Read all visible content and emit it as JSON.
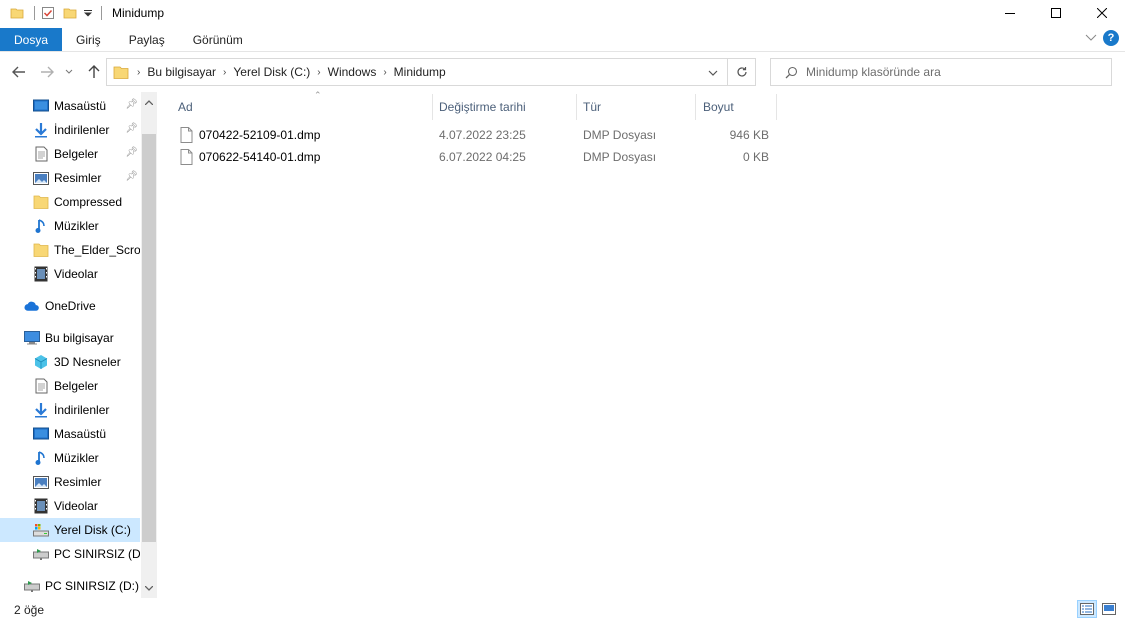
{
  "window": {
    "title": "Minidump",
    "controls": [
      "minimize",
      "maximize",
      "close"
    ]
  },
  "ribbon": {
    "tabs": [
      {
        "label": "Dosya",
        "active": true
      },
      {
        "label": "Giriş"
      },
      {
        "label": "Paylaş"
      },
      {
        "label": "Görünüm"
      }
    ]
  },
  "address": {
    "breadcrumbs": [
      "Bu bilgisayar",
      "Yerel Disk (C:)",
      "Windows",
      "Minidump"
    ]
  },
  "search": {
    "placeholder": "Minidump klasöründe ara"
  },
  "sidebar": {
    "quick_access": [
      {
        "label": "Masaüstü",
        "icon": "desktop-icon",
        "pinned": true
      },
      {
        "label": "İndirilenler",
        "icon": "download-icon",
        "pinned": true
      },
      {
        "label": "Belgeler",
        "icon": "documents-icon",
        "pinned": true
      },
      {
        "label": "Resimler",
        "icon": "pictures-icon",
        "pinned": true
      },
      {
        "label": "Compressed",
        "icon": "folder-icon"
      },
      {
        "label": "Müzikler",
        "icon": "music-icon"
      },
      {
        "label": "The_Elder_Scrolls",
        "icon": "folder-icon"
      },
      {
        "label": "Videolar",
        "icon": "videos-icon"
      }
    ],
    "onedrive": {
      "label": "OneDrive",
      "icon": "onedrive-icon"
    },
    "this_pc": {
      "label": "Bu bilgisayar",
      "icon": "computer-icon"
    },
    "this_pc_items": [
      {
        "label": "3D Nesneler",
        "icon": "3d-objects-icon"
      },
      {
        "label": "Belgeler",
        "icon": "documents-icon"
      },
      {
        "label": "İndirilenler",
        "icon": "download-icon"
      },
      {
        "label": "Masaüstü",
        "icon": "desktop-icon"
      },
      {
        "label": "Müzikler",
        "icon": "music-icon"
      },
      {
        "label": "Resimler",
        "icon": "pictures-icon"
      },
      {
        "label": "Videolar",
        "icon": "videos-icon"
      },
      {
        "label": "Yerel Disk (C:)",
        "icon": "drive-icon",
        "selected": true
      },
      {
        "label": "PC SINIRSIZ (D:)",
        "icon": "network-drive-icon"
      }
    ],
    "network": {
      "label": "PC SINIRSIZ (D:)",
      "icon": "network-drive-icon"
    }
  },
  "columns": {
    "name": "Ad",
    "date": "Değiştirme tarihi",
    "type": "Tür",
    "size": "Boyut"
  },
  "files": [
    {
      "name": "070422-52109-01.dmp",
      "date": "4.07.2022 23:25",
      "type": "DMP Dosyası",
      "size": "946 KB"
    },
    {
      "name": "070622-54140-01.dmp",
      "date": "6.07.2022 04:25",
      "type": "DMP Dosyası",
      "size": "0 KB"
    }
  ],
  "status": {
    "item_count": "2 öğe"
  },
  "colors": {
    "accent": "#1979ca",
    "selection": "#cce8ff",
    "header_text": "#4c607a"
  }
}
